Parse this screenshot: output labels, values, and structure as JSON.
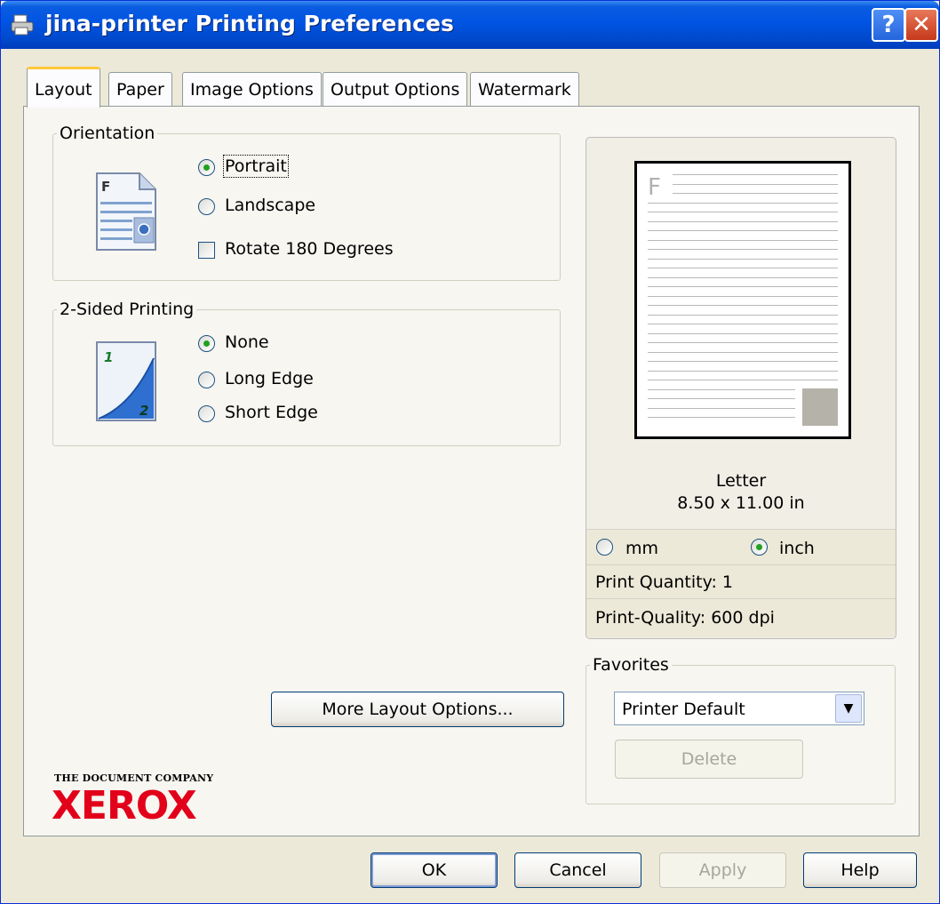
{
  "window": {
    "title": "jina-printer Printing Preferences"
  },
  "tabs": [
    {
      "label": "Layout",
      "active": true
    },
    {
      "label": "Paper",
      "active": false
    },
    {
      "label": "Image Options",
      "active": false
    },
    {
      "label": "Output Options",
      "active": false
    },
    {
      "label": "Watermark",
      "active": false
    }
  ],
  "orientation": {
    "legend": "Orientation",
    "portrait_label": "Portrait",
    "landscape_label": "Landscape",
    "rotate_label": "Rotate 180 Degrees",
    "selected": "Portrait",
    "rotate_checked": false
  },
  "two_sided": {
    "legend": "2-Sided Printing",
    "none_label": "None",
    "long_edge_label": "Long Edge",
    "short_edge_label": "Short Edge",
    "selected": "None"
  },
  "preview": {
    "page_letter": "F",
    "paper_name": "Letter",
    "paper_size": "8.50 x 11.00 in",
    "unit_mm_label": "mm",
    "unit_inch_label": "inch",
    "selected_unit": "inch",
    "print_quantity": "Print Quantity: 1",
    "print_quality": "Print-Quality: 600 dpi"
  },
  "more_layout_button": "More Layout Options...",
  "favorites": {
    "legend": "Favorites",
    "selected": "Printer Default",
    "delete_label": "Delete"
  },
  "branding": {
    "tagline": "THE DOCUMENT COMPANY",
    "logo": "XEROX"
  },
  "buttons": {
    "ok": "OK",
    "cancel": "Cancel",
    "apply": "Apply",
    "help": "Help"
  },
  "title_buttons": {
    "help": "?",
    "close": "✕"
  },
  "colors": {
    "titlebar": "#0054e3",
    "face": "#ece9d8",
    "xerox_red": "#e2001a",
    "tab_highlight": "#ffc83c"
  }
}
